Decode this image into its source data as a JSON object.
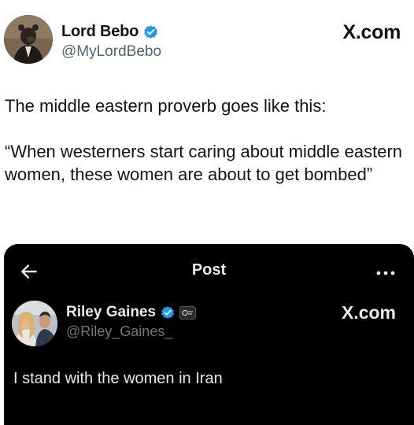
{
  "outer_post": {
    "display_name": "Lord Bebo",
    "handle": "@MyLordBebo",
    "brand": "X.com",
    "text_lines": [
      "The middle eastern proverb goes like this:",
      "“When westerners start caring about middle eastern women, these women are about to get bombed”"
    ],
    "avatar_icon": "bear-portrait-avatar",
    "verified_icon": "verified-badge-icon"
  },
  "quoted_screenshot": {
    "header_title": "Post",
    "back_icon": "arrow-left-icon",
    "more_icon": "more-horizontal-icon",
    "display_name": "Riley Gaines",
    "handle": "@Riley_Gaines_",
    "brand": "X.com",
    "text": "I stand with the women in Iran",
    "avatar_icon": "couple-photo-avatar",
    "verified_icon": "verified-badge-icon",
    "affiliation_icon": "affiliation-badge-icon"
  },
  "colors": {
    "verified_blue": "#1d9bf0",
    "text_primary": "#0f1419",
    "text_secondary": "#536471",
    "dark_background": "#000000",
    "dark_text": "#e7e9ea",
    "dark_secondary": "#71767b"
  }
}
